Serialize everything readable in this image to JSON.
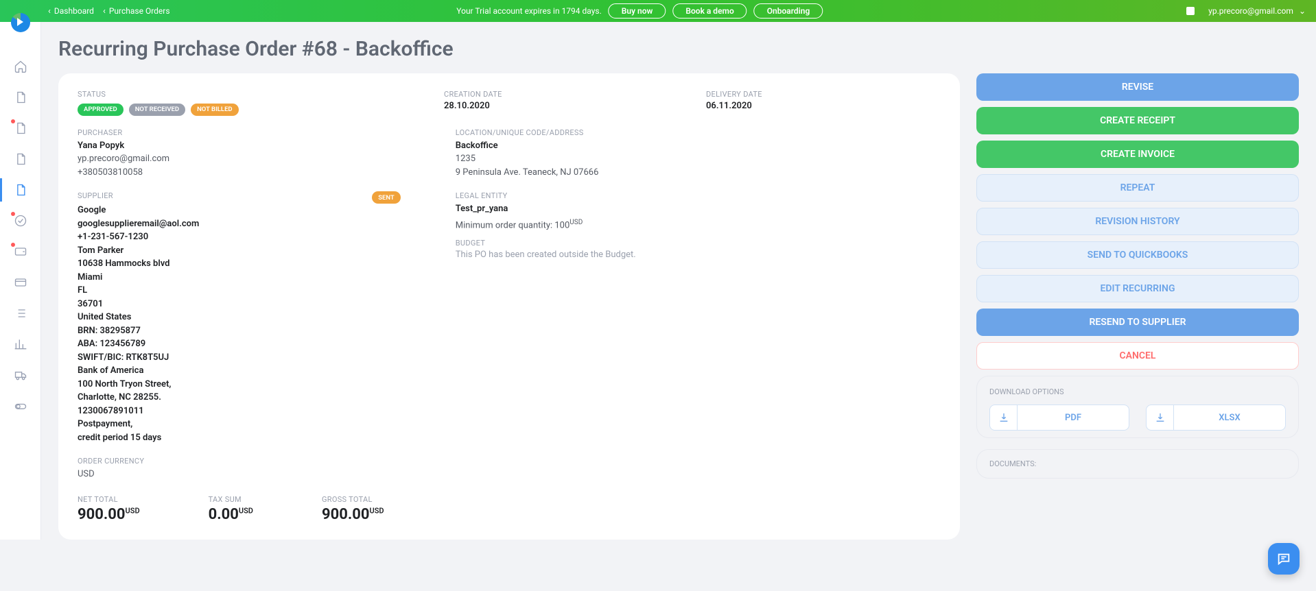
{
  "header": {
    "breadcrumb_dashboard": "Dashboard",
    "breadcrumb_po": "Purchase Orders",
    "trial_text": "Your Trial account expires in 1794 days.",
    "buy_now": "Buy now",
    "book_demo": "Book a demo",
    "onboarding": "Onboarding",
    "user_email": "yp.precoro@gmail.com"
  },
  "page_title": "Recurring Purchase Order #68 - Backoffice",
  "details": {
    "status_label": "STATUS",
    "status_approved": "APPROVED",
    "status_not_received": "NOT RECEIVED",
    "status_not_billed": "NOT BILLED",
    "creation_label": "CREATION DATE",
    "creation_value": "28.10.2020",
    "delivery_label": "DELIVERY DATE",
    "delivery_value": "06.11.2020",
    "purchaser_label": "PURCHASER",
    "purchaser_name": "Yana Popyk",
    "purchaser_email": "yp.precoro@gmail.com",
    "purchaser_phone": "+380503810058",
    "location_label": "LOCATION/UNIQUE CODE/ADDRESS",
    "location_name": "Backoffice",
    "location_code": "1235",
    "location_addr": "9 Peninsula Ave. Teaneck, NJ 07666",
    "supplier_label": "SUPPLIER",
    "supplier_sent": "SENT",
    "supplier_name": "Google",
    "supplier_email": "googlesupplieremail@aol.com",
    "supplier_phone": "+1-231-567-1230",
    "supplier_contact": "Tom Parker",
    "supplier_addr1": "10638 Hammocks blvd",
    "supplier_city": "Miami",
    "supplier_state": "FL",
    "supplier_zip": "36701",
    "supplier_country": "United States",
    "supplier_brn": "BRN: 38295877",
    "supplier_aba": "ABA: 123456789",
    "supplier_swift": "SWIFT/BIC: RTK8T5UJ",
    "supplier_bank": "Bank of America",
    "supplier_bank_addr1": "100 North Tryon Street,",
    "supplier_bank_addr2": "Charlotte, NC 28255.",
    "supplier_acct": "1230067891011",
    "supplier_terms1": "Postpayment,",
    "supplier_terms2": "credit period 15 days",
    "legal_label": "LEGAL ENTITY",
    "legal_value": "Test_pr_yana",
    "min_order_label": "Minimum order quantity: 100",
    "min_order_cur": "USD",
    "budget_label": "BUDGET",
    "budget_text": "This PO has been created outside the Budget.",
    "currency_label": "ORDER CURRENCY",
    "currency_value": "USD",
    "net_label": "NET TOTAL",
    "net_value": "900.00",
    "net_cur": "USD",
    "tax_label": "TAX SUM",
    "tax_value": "0.00",
    "tax_cur": "USD",
    "gross_label": "GROSS TOTAL",
    "gross_value": "900.00",
    "gross_cur": "USD"
  },
  "actions": {
    "revise": "REVISE",
    "create_receipt": "CREATE RECEIPT",
    "create_invoice": "CREATE INVOICE",
    "repeat": "REPEAT",
    "revision_history": "REVISION HISTORY",
    "send_qb": "SEND TO QUICKBOOKS",
    "edit_recurring": "EDIT RECURRING",
    "resend": "RESEND TO SUPPLIER",
    "cancel": "CANCEL"
  },
  "download": {
    "label": "DOWNLOAD OPTIONS",
    "pdf": "PDF",
    "xlsx": "XLSX"
  },
  "documents_label": "DOCUMENTS:"
}
